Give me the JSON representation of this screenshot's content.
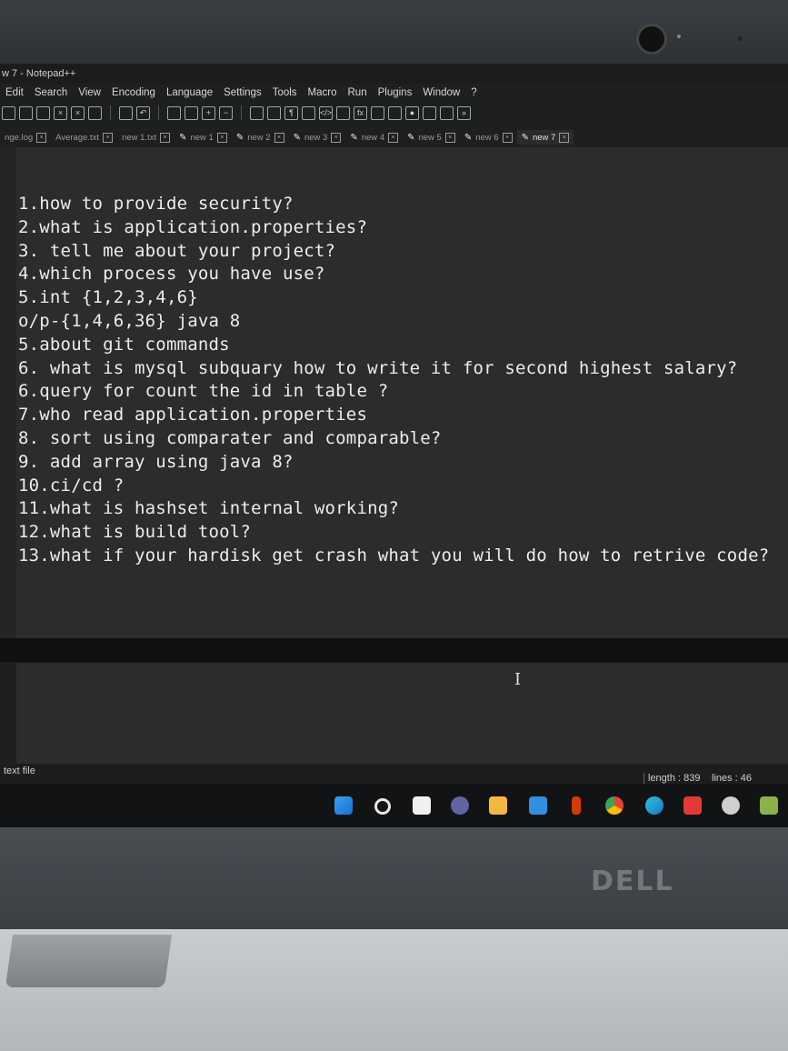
{
  "window": {
    "title": "w 7 - Notepad++"
  },
  "menu": [
    "Edit",
    "Search",
    "View",
    "Encoding",
    "Language",
    "Settings",
    "Tools",
    "Macro",
    "Run",
    "Plugins",
    "Window",
    "?"
  ],
  "tabs": [
    {
      "label": "nge.log",
      "modified": false,
      "active": false
    },
    {
      "label": "Average.txt",
      "modified": false,
      "active": false
    },
    {
      "label": "new 1.txt",
      "modified": false,
      "active": false
    },
    {
      "label": "new 1",
      "modified": true,
      "active": false
    },
    {
      "label": "new 2",
      "modified": true,
      "active": false
    },
    {
      "label": "new 3",
      "modified": true,
      "active": false
    },
    {
      "label": "new 4",
      "modified": true,
      "active": false
    },
    {
      "label": "new 5",
      "modified": true,
      "active": false
    },
    {
      "label": "new 6",
      "modified": true,
      "active": false
    },
    {
      "label": "new 7",
      "modified": true,
      "active": true
    }
  ],
  "editor": {
    "lines": [
      "1.how to provide security?",
      "2.what is application.properties?",
      "3. tell me about your project?",
      "4.which process you have use?",
      "5.int {1,2,3,4,6}",
      "o/p-{1,4,6,36} java 8",
      "5.about git commands",
      "6. what is mysql subquary how to write it for second highest salary?",
      "6.query for count the id in table ?",
      "7.who read application.properties",
      "8. sort using comparater and comparable?",
      "9. add array using java 8?",
      "10.ci/cd ?",
      "11.what is hashset internal working?",
      "12.what is build tool?",
      "13.what if your hardisk get crash what you will do how to retrive code?"
    ]
  },
  "status": {
    "file_type": "text file",
    "length": "length : 839",
    "lines": "lines : 46"
  },
  "hardware": {
    "brand": "DELL"
  },
  "colors": {
    "editor_bg": "#2b2c2b",
    "text": "#ececec",
    "screen_bg": "#1e1f1f"
  }
}
